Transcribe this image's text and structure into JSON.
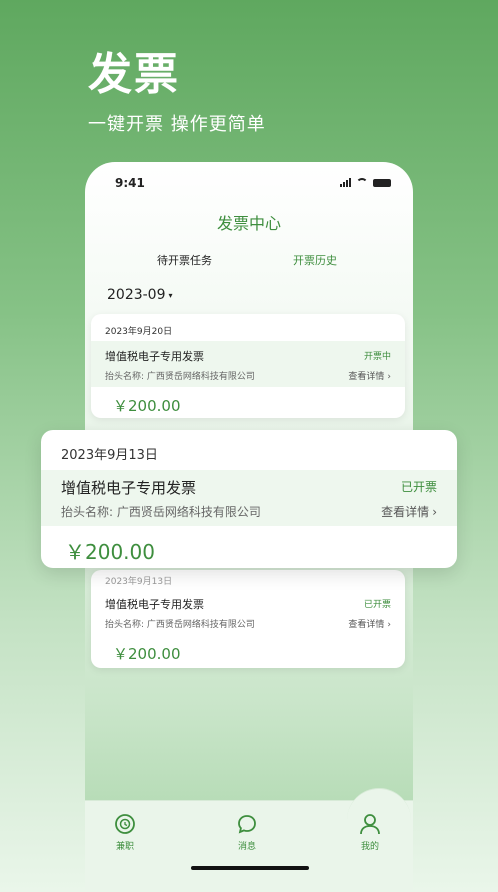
{
  "promo": {
    "title": "发票",
    "subtitle": "一键开票  操作更简单"
  },
  "status_bar": {
    "time": "9:41"
  },
  "page": {
    "title": "发票中心"
  },
  "tabs": {
    "pending": "待开票任务",
    "history": "开票历史"
  },
  "month_filter": {
    "value": "2023-09",
    "caret": "▾"
  },
  "invoices": [
    {
      "date": "2023年9月20日",
      "type": "增值税电子专用发票",
      "status": "开票中",
      "header_name": "抬头名称: 广西贤岳网络科技有限公司",
      "details_label": "查看详情",
      "amount": "￥200.00"
    },
    {
      "date": "2023年9月13日",
      "type": "增值税电子专用发票",
      "status": "已开票",
      "header_name": "抬头名称: 广西贤岳网络科技有限公司",
      "details_label": "查看详情",
      "amount": "￥200.00"
    },
    {
      "date": "2023年9月13日",
      "type": "增值税电子专用发票",
      "status": "已开票",
      "header_name": "抬头名称: 广西贤岳网络科技有限公司",
      "details_label": "查看详情",
      "amount": "￥200.00"
    }
  ],
  "bottom_nav": [
    {
      "label": "兼职",
      "icon": "clock-icon"
    },
    {
      "label": "消息",
      "icon": "chat-bubble-icon"
    },
    {
      "label": "我的",
      "icon": "person-icon"
    }
  ],
  "colors": {
    "accent": "#3e8e3e",
    "band": "#eef7ee"
  }
}
